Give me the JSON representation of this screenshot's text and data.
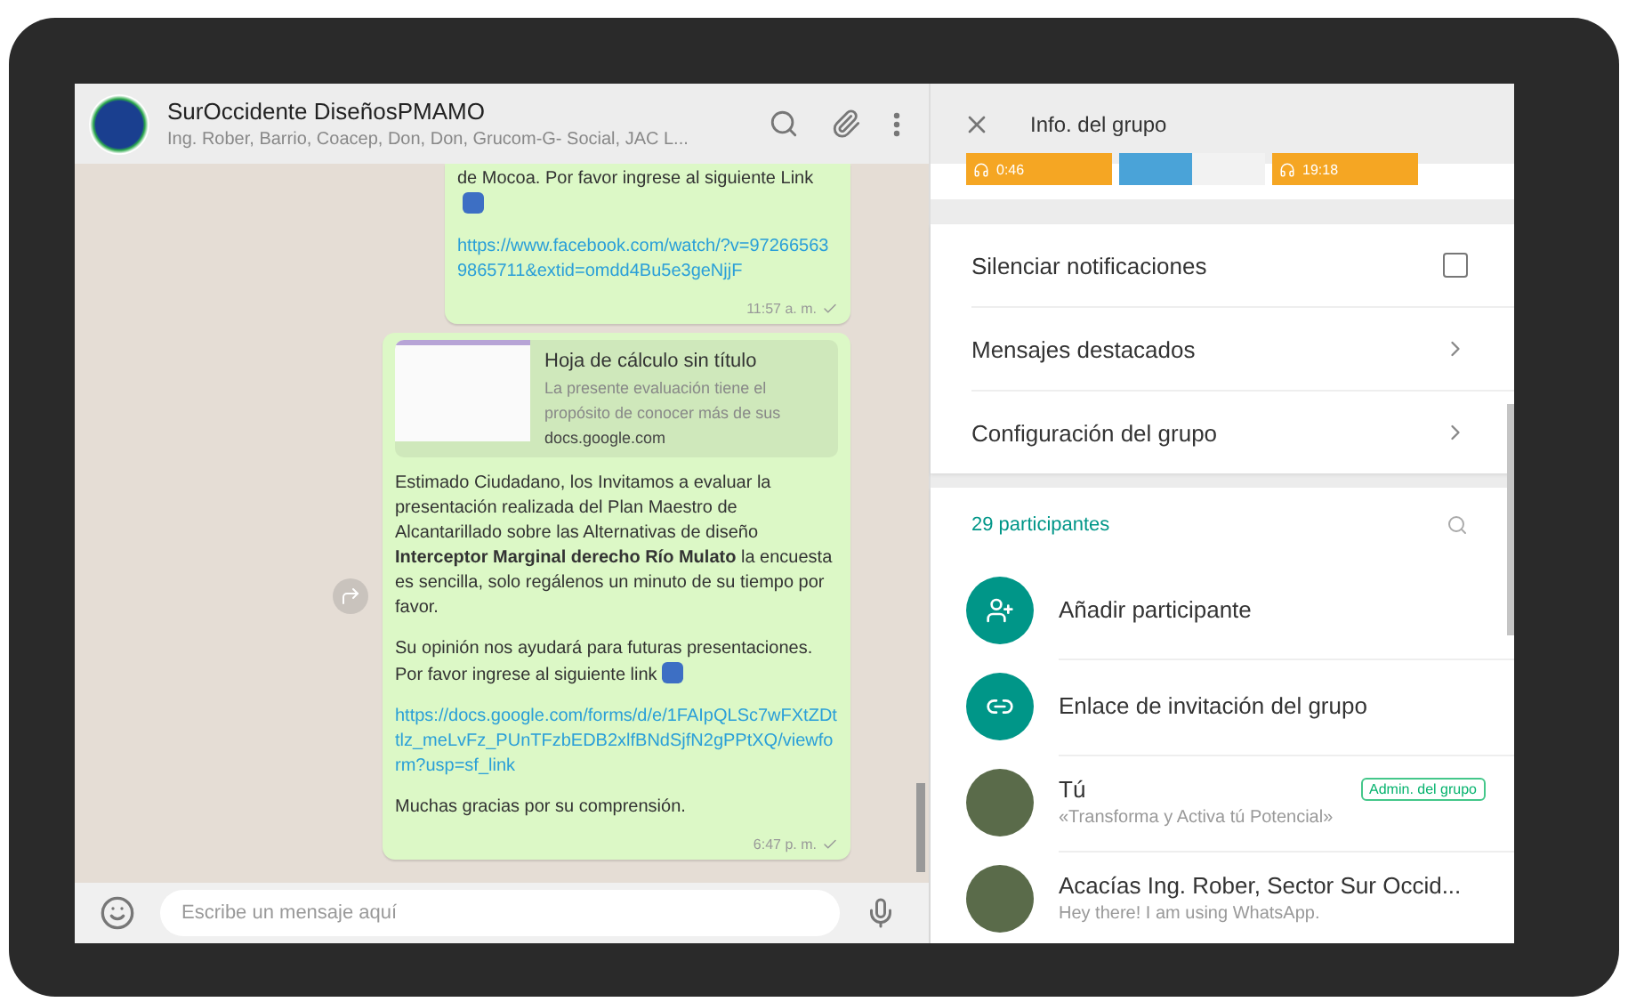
{
  "chat": {
    "title": "SurOccidente DiseñosPMAMO",
    "subtitle": "Ing. Rober, Barrio, Coacep, Don, Don, Grucom-G- Social, JAC L...",
    "messages": [
      {
        "cut_top": true,
        "blocks": [
          {
            "kind": "text",
            "text": "de Mocoa. Por favor ingrese al siguiente Link",
            "arrow_emoji": true
          },
          {
            "kind": "link",
            "text": "https://www.facebook.com/watch/?v=972665639865711&extid=omdd4Bu5e3geNjjF"
          }
        ],
        "time": "11:57 a. m."
      },
      {
        "cut_top": false,
        "forward": true,
        "preview": {
          "title": "Hoja de cálculo sin título",
          "description": "La presente evaluación tiene el propósito de conocer más de sus",
          "domain": "docs.google.com"
        },
        "blocks": [
          {
            "kind": "text",
            "text": "Estimado Ciudadano, los Invitamos a evaluar la presentación realizada del Plan Maestro de Alcantarillado sobre las Alternativas de diseño **Interceptor Marginal derecho Río Mulato** la encuesta es sencilla, solo regálenos un minuto de su tiempo por favor."
          },
          {
            "kind": "text",
            "text": "Su opinión nos ayudará para futuras presentaciones. Por favor ingrese al siguiente link",
            "arrow_emoji": true
          },
          {
            "kind": "link",
            "text": "https://docs.google.com/forms/d/e/1FAIpQLSc7wFXtZDttlz_meLvFz_PUnTFzbEDB2xlfBNdSjfN2gPPtXQ/viewform?usp=sf_link"
          },
          {
            "kind": "text",
            "text": "Muchas gracias por su comprensión."
          }
        ],
        "time": "6:47 p. m."
      }
    ],
    "composer": {
      "placeholder": "Escribe un mensaje aquí"
    }
  },
  "info": {
    "title": "Info. del grupo",
    "media": [
      {
        "kind": "audio",
        "duration": "0:46"
      },
      {
        "kind": "image"
      },
      {
        "kind": "audio",
        "duration": "19:18"
      }
    ],
    "options": [
      {
        "kind": "checkbox",
        "label": "Silenciar notificaciones",
        "checked": false
      },
      {
        "kind": "link",
        "label": "Mensajes destacados"
      },
      {
        "kind": "link",
        "label": "Configuración del grupo"
      }
    ],
    "participants_label": "29 participantes",
    "actions": [
      {
        "kind": "add",
        "label": "Añadir participante"
      },
      {
        "kind": "invite",
        "label": "Enlace de invitación del grupo"
      }
    ],
    "members": [
      {
        "name": "Tú",
        "status": "«Transforma y Activa tú Potencial»",
        "badge": "Admin. del grupo"
      },
      {
        "name": "Acacías Ing. Rober, Sector Sur Occid...",
        "status": "Hey there! I am using WhatsApp."
      }
    ]
  }
}
